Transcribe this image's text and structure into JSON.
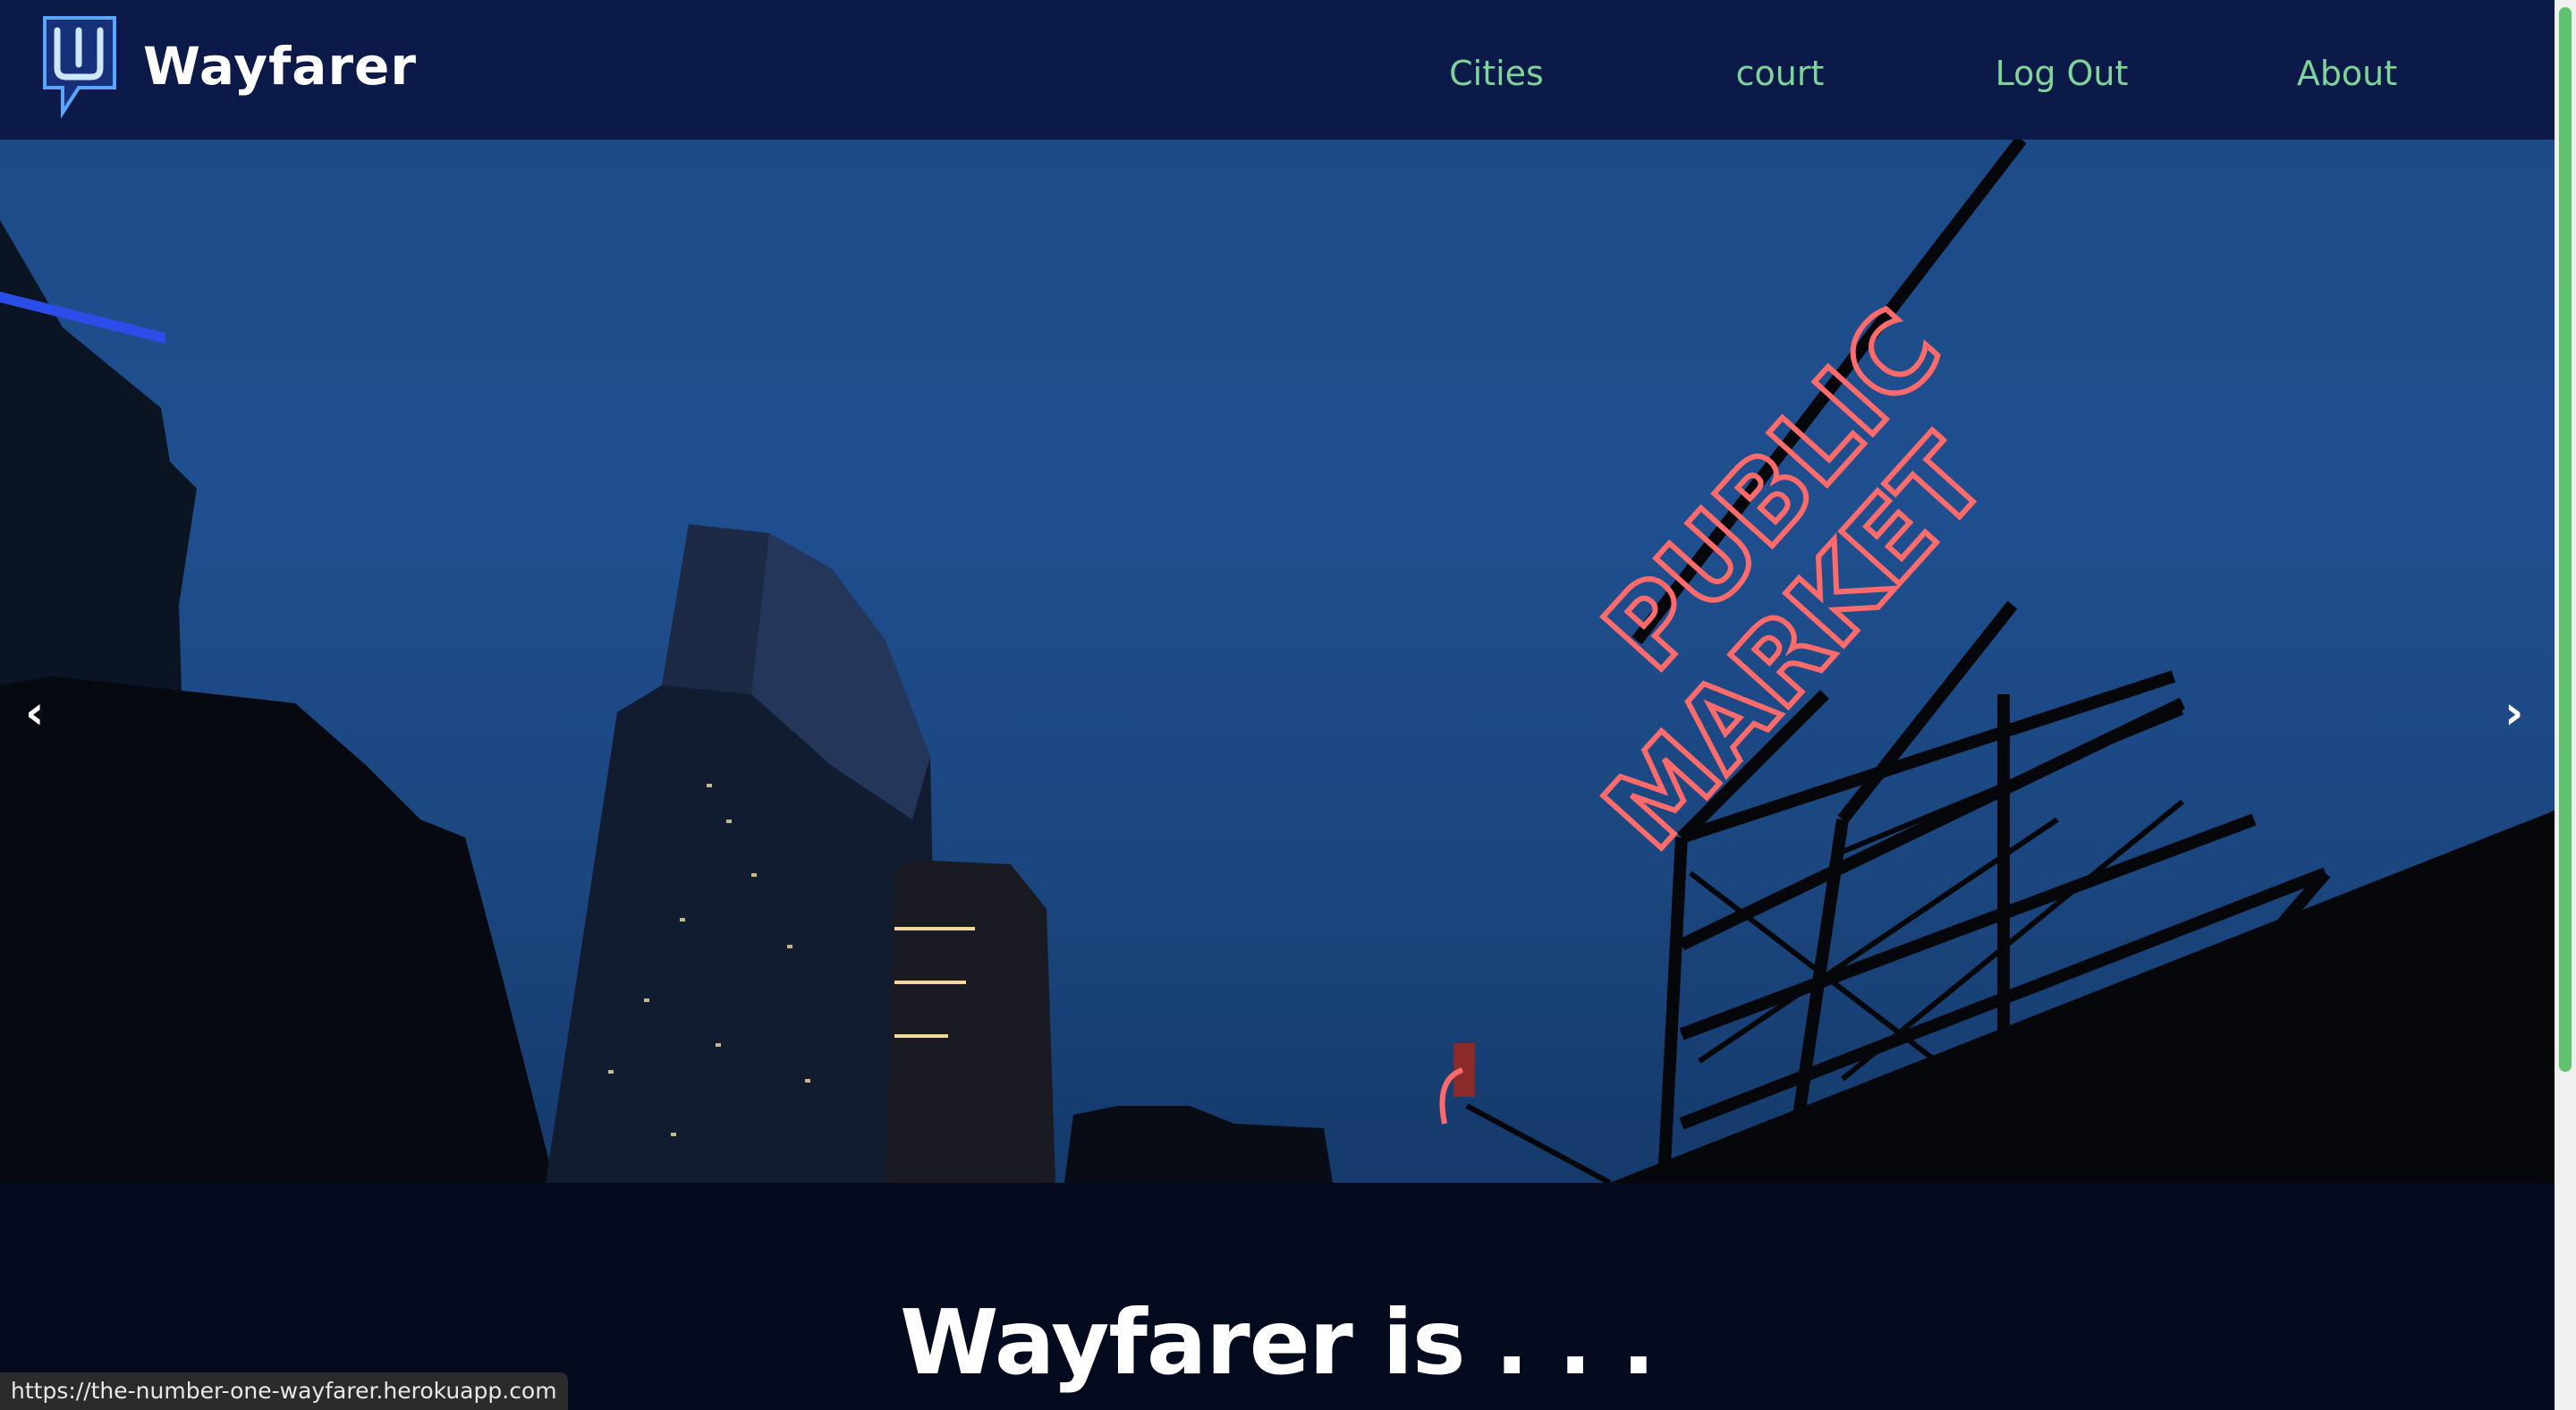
{
  "brand": {
    "name": "Wayfarer",
    "logo_icon": "wayfarer-w-logo"
  },
  "nav": {
    "items": [
      {
        "label": "Cities"
      },
      {
        "label": "court"
      },
      {
        "label": "Log Out"
      },
      {
        "label": "About"
      }
    ]
  },
  "carousel": {
    "prev_label": "‹",
    "next_label": "›",
    "slide_sign_line1": "PUBLIC",
    "slide_sign_line2": "MARKET"
  },
  "intro": {
    "title": "Wayfarer is . . ."
  },
  "status_bar": {
    "url": "https://the-number-one-wayfarer.herokuapp.com"
  },
  "colors": {
    "nav_bg": "#0b1a48",
    "nav_link": "#7fd49a",
    "sky": "#1f4f8f",
    "neon": "#ff5a5a",
    "scroll_thumb": "#5ec26f",
    "intro_bg": "#040b1f"
  }
}
